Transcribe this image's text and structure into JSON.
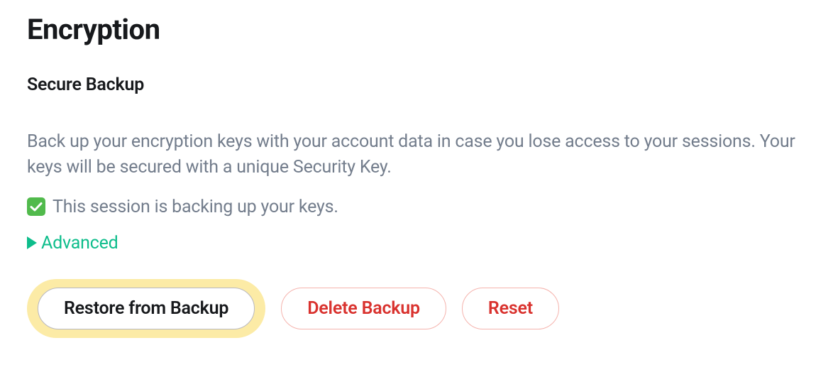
{
  "heading": "Encryption",
  "subheading": "Secure Backup",
  "description": "Back up your encryption keys with your account data in case you lose access to your sessions. Your keys will be secured with a unique Security Key.",
  "status": {
    "text": "This session is backing up your keys.",
    "ok": true
  },
  "advanced_label": "Advanced",
  "buttons": {
    "restore": "Restore from Backup",
    "delete": "Delete Backup",
    "reset": "Reset"
  },
  "colors": {
    "accent": "#0dbd8b",
    "danger": "#d9322e",
    "text_secondary": "#737d8c",
    "highlight": "#fceba6",
    "check_bg": "#51ba4c"
  }
}
